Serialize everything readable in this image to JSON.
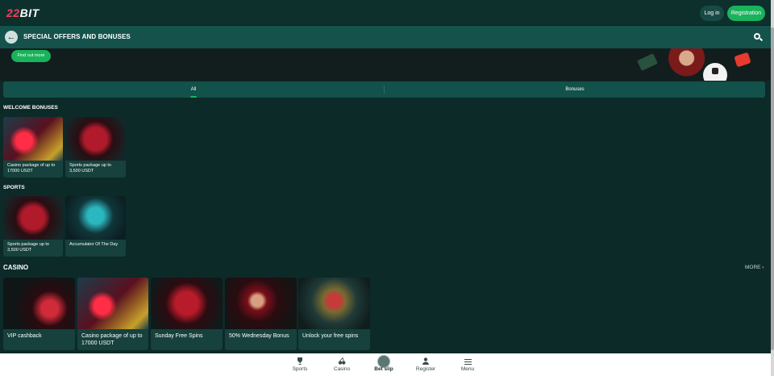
{
  "header": {
    "logo_num": "22",
    "logo_text": "BIT",
    "login_label": "Log in",
    "registration_label": "Registration"
  },
  "titlebar": {
    "back_symbol": "←",
    "title": "SPECIAL OFFERS AND BONUSES"
  },
  "banner": {
    "find_out_label": "Find out more"
  },
  "tabs": [
    {
      "label": "All",
      "active": true
    },
    {
      "label": "Bonuses",
      "active": false
    }
  ],
  "sections": {
    "welcome": {
      "title": "WELCOME BONUSES",
      "cards": [
        {
          "label": "Casino package of up to 17000 USDT",
          "image": "casino-package-art"
        },
        {
          "label": "Sports package up to 3,500 USDT",
          "image": "sports-package-art"
        }
      ]
    },
    "sports": {
      "title": "SPORTS",
      "cards": [
        {
          "label": "Sports package up to 3,500 USDT",
          "image": "sports-package-art"
        },
        {
          "label": "Accumulator Of The Day",
          "image": "accumulator-art"
        }
      ]
    },
    "casino": {
      "title": "CASINO",
      "more_label": "MORE ›",
      "cards": [
        {
          "label": "VIP cashback",
          "image": "vip-art"
        },
        {
          "label": "Casino package of up to 17000 USDT",
          "image": "casino-package-art"
        },
        {
          "label": "Sunday Free Spins",
          "image": "free-spins-art"
        },
        {
          "label": "50% Wednesday Bonus",
          "image": "wednesday-art"
        },
        {
          "label": "Unlock your free spins",
          "image": "unlock-spins-art"
        }
      ]
    }
  },
  "bottom_nav": [
    {
      "label": "Sports",
      "icon": "trophy-icon"
    },
    {
      "label": "Casino",
      "icon": "cherries-icon"
    },
    {
      "label": "Bet slip",
      "icon": "betslip-icon"
    },
    {
      "label": "Register",
      "icon": "person-icon"
    },
    {
      "label": "Menu",
      "icon": "menu-icon"
    }
  ],
  "colors": {
    "background": "#0c2a28",
    "accent_green": "#18b35c",
    "titlebar": "#15524c",
    "logo_red": "#ff3b5c"
  }
}
